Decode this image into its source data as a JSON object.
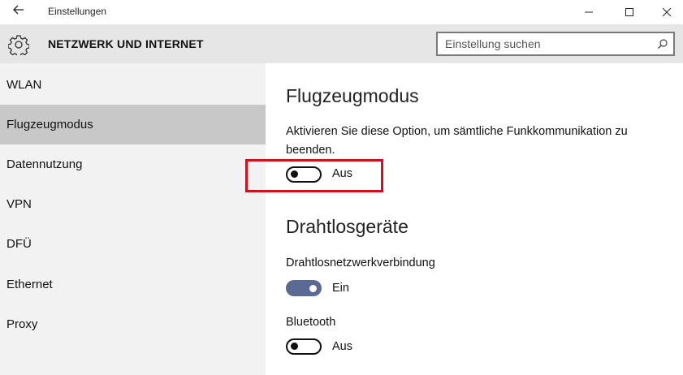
{
  "window": {
    "title": "Einstellungen"
  },
  "header": {
    "section_title": "NETZWERK UND INTERNET",
    "search_placeholder": "Einstellung suchen"
  },
  "sidebar": {
    "items": [
      {
        "label": "WLAN",
        "active": false
      },
      {
        "label": "Flugzeugmodus",
        "active": true
      },
      {
        "label": "Datennutzung",
        "active": false
      },
      {
        "label": "VPN",
        "active": false
      },
      {
        "label": "DFÜ",
        "active": false
      },
      {
        "label": "Ethernet",
        "active": false
      },
      {
        "label": "Proxy",
        "active": false
      }
    ]
  },
  "main": {
    "airplane": {
      "heading": "Flugzeugmodus",
      "description": "Aktivieren Sie diese Option, um sämtliche Funkkommunikation zu beenden.",
      "toggle_state": "Aus",
      "toggle_on": false
    },
    "wireless": {
      "heading": "Drahtlosgeräte",
      "wifi": {
        "label": "Drahtlosnetzwerkverbindung",
        "state": "Ein",
        "on": true
      },
      "bluetooth": {
        "label": "Bluetooth",
        "state": "Aus",
        "on": false
      }
    }
  },
  "colors": {
    "toggle_on": "#5a6a93",
    "highlight": "#cf1020",
    "header_bg": "#e6e6e6",
    "sidebar_bg": "#f2f2f2",
    "nav_active_bg": "#c8c8c8"
  }
}
